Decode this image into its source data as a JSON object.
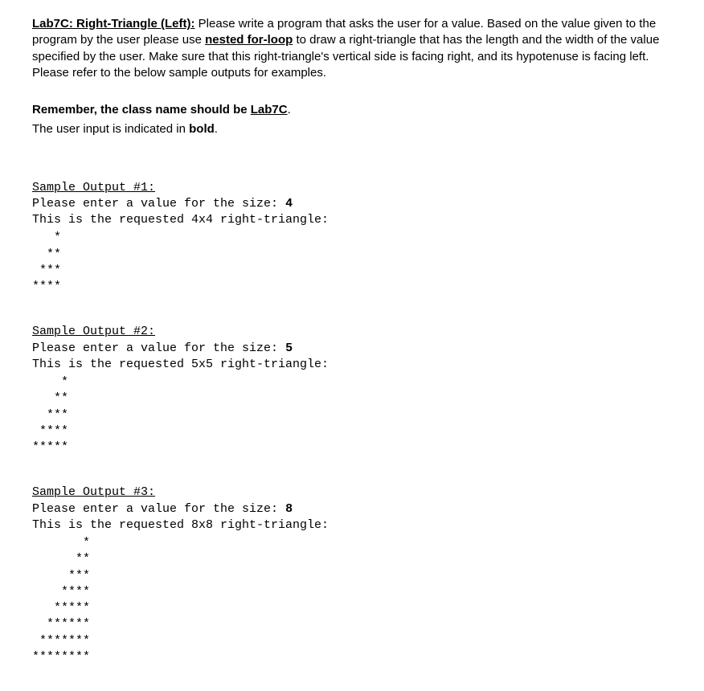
{
  "intro": {
    "title": "Lab7C: Right-Triangle (Left):",
    "desc_before": " Please write a program that asks the user for a value. Based on the value given to the program by the user please use ",
    "keyword": "nested for-loop",
    "desc_after": " to draw a right-triangle that has the length and the width of the value specified by the user. Make sure that this right-triangle's vertical side is facing right, and its hypotenuse is facing left. Please refer to the below sample outputs for examples."
  },
  "note": {
    "line1_before": "Remember, the class name should be ",
    "classname": "Lab7C",
    "line1_after": ".",
    "line2_before": "The user input is indicated in ",
    "line2_bold": "bold",
    "line2_after": "."
  },
  "samples": [
    {
      "header": "Sample Output #1:",
      "prompt": "Please enter a value for the size: ",
      "input": "4",
      "result": "This is the requested 4x4 right-triangle:",
      "size": 4
    },
    {
      "header": "Sample Output #2:",
      "prompt": "Please enter a value for the size: ",
      "input": "5",
      "result": "This is the requested 5x5 right-triangle:",
      "size": 5
    },
    {
      "header": "Sample Output #3:",
      "prompt": "Please enter a value for the size: ",
      "input": "8",
      "result": "This is the requested 8x8 right-triangle:",
      "size": 8
    }
  ]
}
